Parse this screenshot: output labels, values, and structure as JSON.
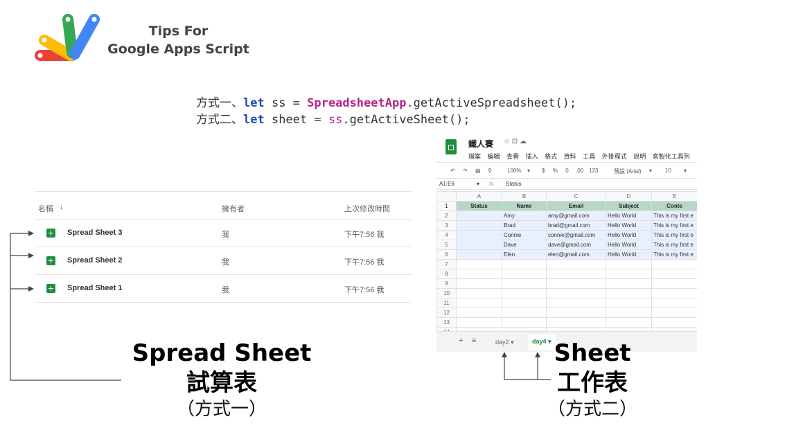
{
  "brand": {
    "line1": "Tips For",
    "line2": "Google Apps Script",
    "logo_colors": [
      "#34a853",
      "#fbbc04",
      "#4285f4",
      "#ea4335"
    ]
  },
  "code": {
    "line1": {
      "prefix": "方式一、",
      "kw": "let",
      "var": " ss = ",
      "cls": "SpreadsheetApp",
      "rest": ".getActiveSpreadsheet();"
    },
    "line2": {
      "prefix": "方式二、",
      "kw": "let",
      "var": " sheet = ",
      "cls": "ss",
      "rest": ".getActiveSheet();"
    }
  },
  "drive": {
    "headers": {
      "name": "名稱",
      "owner": "擁有者",
      "modified": "上次修改時間"
    },
    "rows": [
      {
        "name": "Spread Sheet 3",
        "owner": "我",
        "modified": "下午7:56 我"
      },
      {
        "name": "Spread Sheet 2",
        "owner": "我",
        "modified": "下午7:56 我"
      },
      {
        "name": "Spread Sheet 1",
        "owner": "我",
        "modified": "下午7:56 我"
      }
    ]
  },
  "sheet_app": {
    "title": "鐵人賽",
    "title_icons": "☆ ⊡ ☁",
    "menu": [
      "檔案",
      "編輯",
      "查看",
      "插入",
      "格式",
      "資料",
      "工具",
      "外掛程式",
      "說明",
      "客製化工具列"
    ],
    "toolbar": {
      "zoom": "100%",
      "currency": "$",
      "percent": "%",
      "dec1": ".0",
      "dec2": ".00",
      "fmt": "123",
      "font": "預設 (Arial)",
      "size": "10"
    },
    "cell_ref": "A1:E6",
    "formula": "Status",
    "columns": [
      "A",
      "B",
      "C",
      "D",
      "E"
    ],
    "header_row": [
      "Status",
      "Name",
      "Email",
      "Subject",
      "Conte"
    ],
    "rows": [
      [
        "",
        "Amy",
        "amy@gmail.com",
        "Hello World",
        "This is my first e"
      ],
      [
        "",
        "Brad",
        "brad@gmail.com",
        "Hello World",
        "This is my first e"
      ],
      [
        "",
        "Connie",
        "connie@gmail.com",
        "Hello World",
        "This is my first e"
      ],
      [
        "",
        "Dave",
        "dave@gmail.com",
        "Hello World",
        "This is my first e"
      ],
      [
        "",
        "Elen",
        "elen@gmail.com",
        "Hello World",
        "This is my first e"
      ]
    ],
    "empty_row_numbers": [
      "7",
      "8",
      "9",
      "10",
      "11",
      "12",
      "13",
      "14"
    ],
    "tabs": {
      "add": "+",
      "list": "≡",
      "tab1": "day2 ▾",
      "tab2": "day4 ▾"
    }
  },
  "captions": {
    "left_en": "Spread Sheet",
    "left_zh": "試算表",
    "left_sub": "（方式一）",
    "right_en": "Sheet",
    "right_zh": "工作表",
    "right_sub": "（方式二）"
  }
}
